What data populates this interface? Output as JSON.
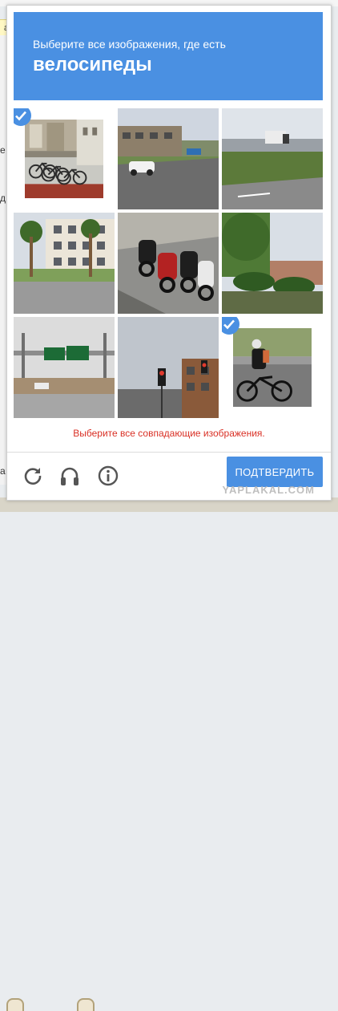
{
  "header": {
    "line1": "Выберите все изображения, где есть",
    "line2": "велосипеды"
  },
  "tiles": [
    {
      "name": "tile-bicycles-rack",
      "selected": true
    },
    {
      "name": "tile-street-car",
      "selected": false
    },
    {
      "name": "tile-highway-truck",
      "selected": false
    },
    {
      "name": "tile-building-palms",
      "selected": false
    },
    {
      "name": "tile-motorcycles",
      "selected": false
    },
    {
      "name": "tile-palm-trees",
      "selected": false
    },
    {
      "name": "tile-highway-sign",
      "selected": false
    },
    {
      "name": "tile-traffic-light",
      "selected": false
    },
    {
      "name": "tile-cyclist",
      "selected": true
    }
  ],
  "error_message": "Выберите все совпадающие изображения.",
  "controls": {
    "icons": [
      "reload-icon",
      "headphones-icon",
      "info-icon"
    ],
    "verify_label": "ПОДТВЕРДИТЬ"
  },
  "watermark": "YAPLAKAL.COM",
  "colors": {
    "accent": "#4a90e2",
    "error": "#d93025"
  }
}
